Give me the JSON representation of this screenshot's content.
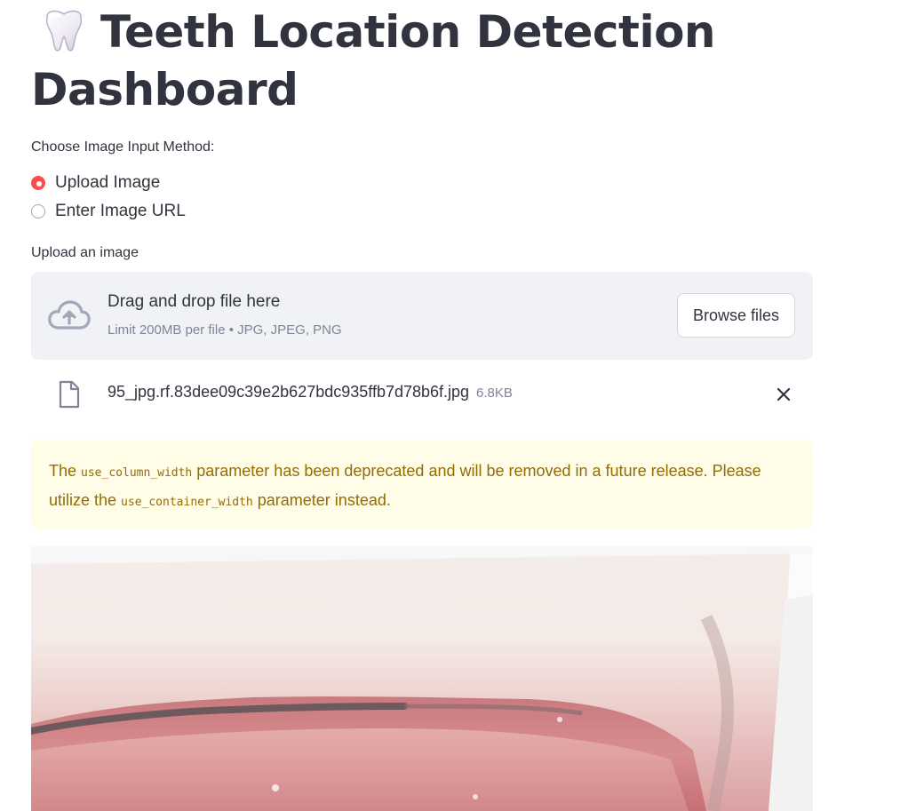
{
  "header": {
    "title_line1": "Teeth Location Detection",
    "title_line2": "Dashboard",
    "icon": "tooth-icon"
  },
  "input_method": {
    "label": "Choose Image Input Method:",
    "options": [
      {
        "label": "Upload Image",
        "selected": true
      },
      {
        "label": "Enter Image URL",
        "selected": false
      }
    ]
  },
  "uploader": {
    "label": "Upload an image",
    "drop_text": "Drag and drop file here",
    "limit_text": "Limit 200MB per file • JPG, JPEG, PNG",
    "browse_label": "Browse files",
    "icon": "cloud-upload-icon"
  },
  "uploaded_file": {
    "name": "95_jpg.rf.83dee09c39e2b627bdc935ffb7d78b6f.jpg",
    "size": "6.8KB",
    "icon": "file-icon",
    "remove_icon": "close-icon"
  },
  "warning": {
    "text_1": "The ",
    "code_1": "use_column_width",
    "text_2": " parameter has been deprecated and will be removed in a future release. Please utilize the ",
    "code_2": "use_container_width",
    "text_3": " parameter instead."
  },
  "colors": {
    "accent": "#ff4b4b",
    "warning_bg": "#fffce8",
    "warning_text": "#926c05",
    "dropzone_bg": "#f0f2f6"
  }
}
